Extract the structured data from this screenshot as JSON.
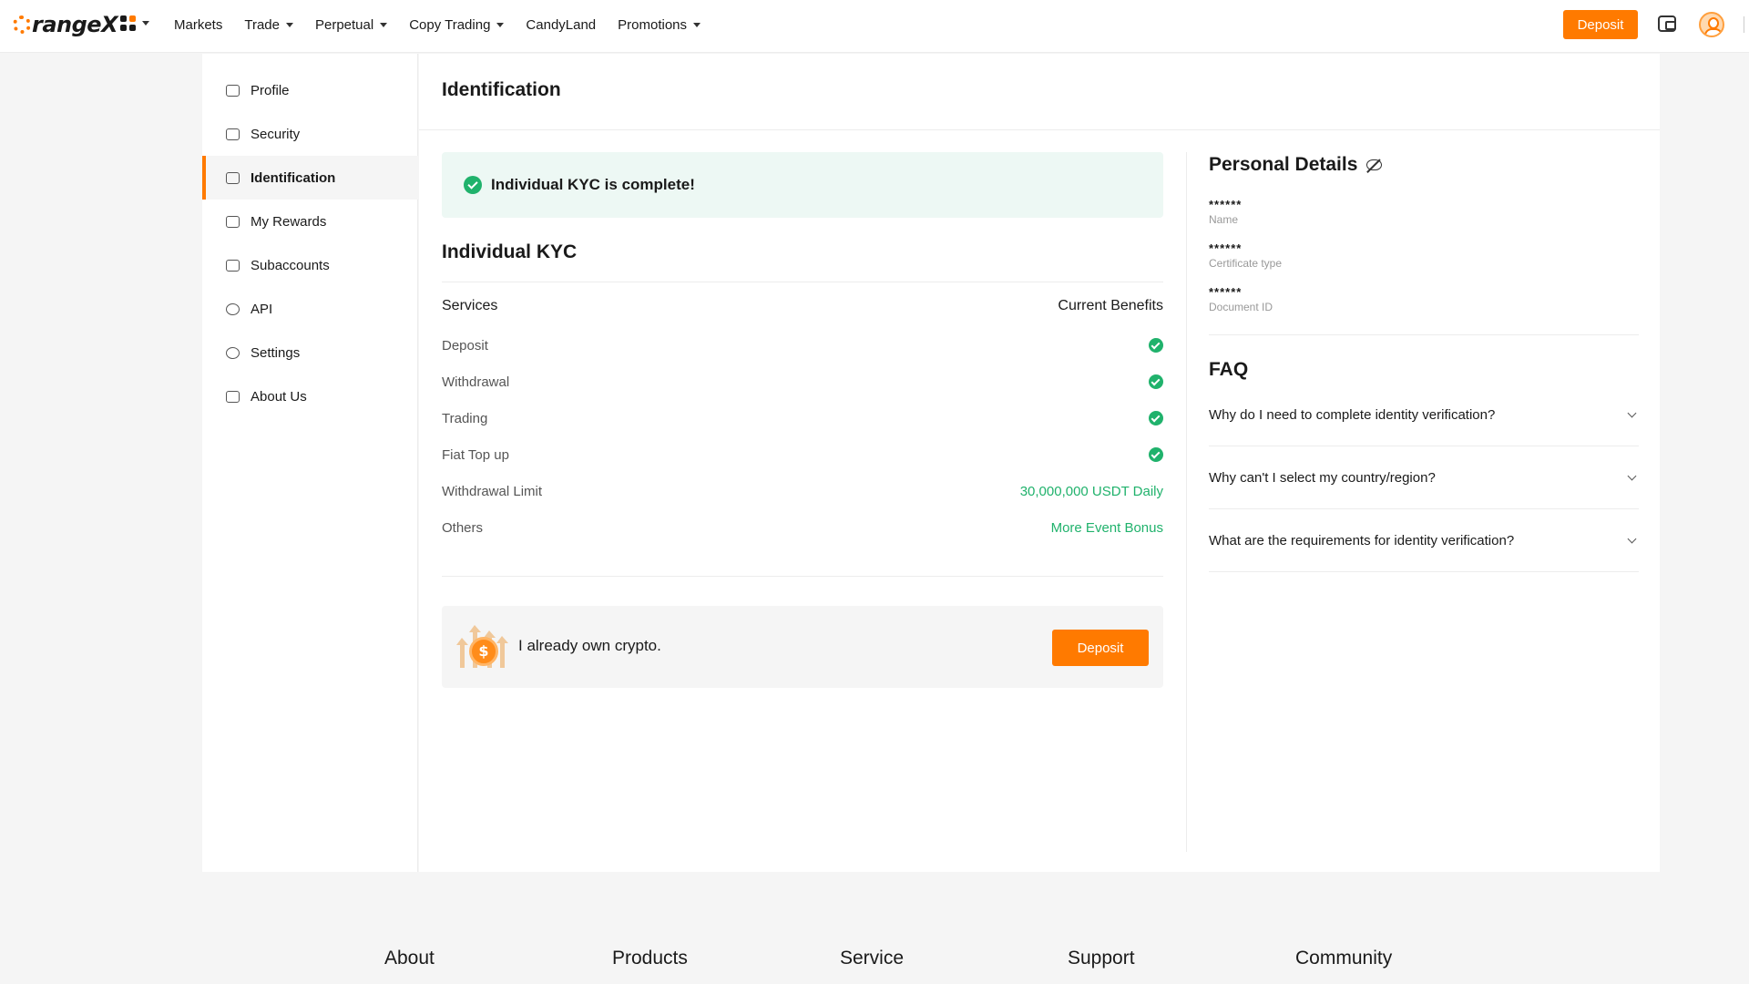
{
  "header": {
    "logo_text": "rangeX",
    "nav": [
      {
        "label": "Markets",
        "dropdown": false
      },
      {
        "label": "Trade",
        "dropdown": true
      },
      {
        "label": "Perpetual",
        "dropdown": true
      },
      {
        "label": "Copy Trading",
        "dropdown": true
      },
      {
        "label": "CandyLand",
        "dropdown": false
      },
      {
        "label": "Promotions",
        "dropdown": true
      }
    ],
    "deposit_label": "Deposit",
    "icons": [
      "apps-grid-icon",
      "wallet-icon",
      "avatar"
    ]
  },
  "sidebar": {
    "items": [
      {
        "label": "Profile",
        "icon": "profile-icon"
      },
      {
        "label": "Security",
        "icon": "lock-icon"
      },
      {
        "label": "Identification",
        "icon": "id-card-icon",
        "active": true
      },
      {
        "label": "My Rewards",
        "icon": "gift-icon"
      },
      {
        "label": "Subaccounts",
        "icon": "org-chart-icon"
      },
      {
        "label": "API",
        "icon": "link-icon"
      },
      {
        "label": "Settings",
        "icon": "gear-icon"
      },
      {
        "label": "About Us",
        "icon": "monitor-icon"
      }
    ]
  },
  "main": {
    "title": "Identification",
    "kyc_banner": "Individual KYC is complete!",
    "kyc_section_title": "Individual KYC",
    "services_header": "Services",
    "benefits_header": "Current Benefits",
    "services": [
      {
        "label": "Deposit",
        "value": "",
        "check": true
      },
      {
        "label": "Withdrawal",
        "value": "",
        "check": true
      },
      {
        "label": "Trading",
        "value": "",
        "check": true
      },
      {
        "label": "Fiat Top up",
        "value": "",
        "check": true
      },
      {
        "label": "Withdrawal Limit",
        "value": "30,000,000 USDT Daily",
        "check": false
      },
      {
        "label": "Others",
        "value": "More Event Bonus",
        "check": false
      }
    ],
    "crypto_card": {
      "text": "I already own crypto.",
      "button": "Deposit"
    }
  },
  "personal_details": {
    "title": "Personal Details",
    "fields": [
      {
        "value": "******",
        "label": "Name"
      },
      {
        "value": "******",
        "label": "Certificate type"
      },
      {
        "value": "******",
        "label": "Document ID"
      }
    ]
  },
  "faq": {
    "title": "FAQ",
    "items": [
      "Why do I need to complete identity verification?",
      "Why can't I select my country/region?",
      "What are the requirements for identity verification?"
    ]
  },
  "footer": {
    "columns": [
      "About",
      "Products",
      "Service",
      "Support",
      "Community"
    ]
  },
  "colors": {
    "brand": "#ff7a00",
    "success": "#20b26c",
    "banner_bg": "#edf8f4"
  }
}
